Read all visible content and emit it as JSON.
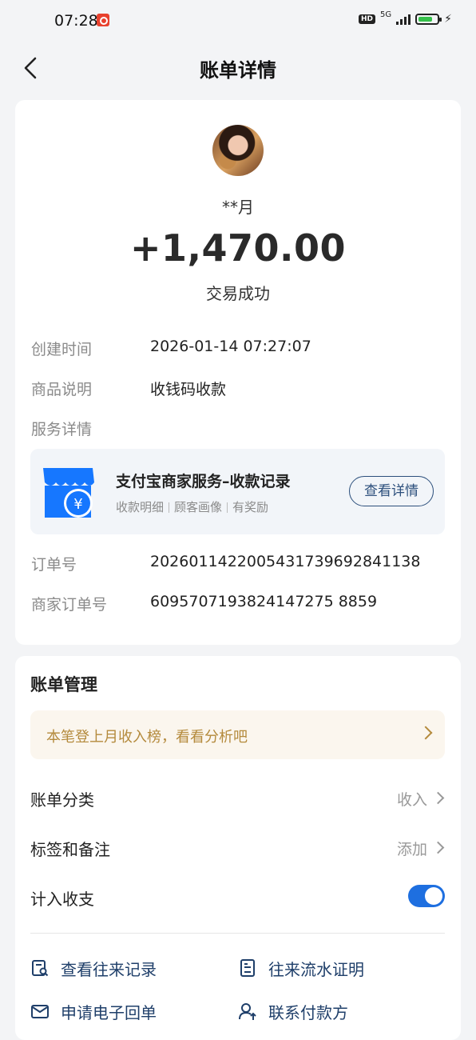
{
  "status_bar": {
    "time": "07:28",
    "net": "5G",
    "hd": "HD",
    "battery_level": 0.75
  },
  "header": {
    "title": "账单详情"
  },
  "transaction": {
    "payer_name": "**月",
    "amount": "+1,470.00",
    "status": "交易成功",
    "details": [
      {
        "label": "创建时间",
        "value": "2026-01-14 07:27:07"
      },
      {
        "label": "商品说明",
        "value": "收钱码收款"
      },
      {
        "label": "服务详情",
        "value": ""
      }
    ],
    "service": {
      "title": "支付宝商家服务–收款记录",
      "tags": [
        "收款明细",
        "顾客画像",
        "有奖励"
      ],
      "button": "查看详情"
    },
    "order_rows": [
      {
        "label": "订单号",
        "value": "2026011422005431739692841138"
      },
      {
        "label": "商家订单号",
        "value": "6095707193824147275 8859"
      }
    ]
  },
  "management": {
    "title": "账单管理",
    "notice": "本笔登上月收入榜，看看分析吧",
    "rows": [
      {
        "label": "账单分类",
        "value": "收入"
      },
      {
        "label": "标签和备注",
        "value": "添加"
      },
      {
        "label": "计入收支",
        "value": ""
      }
    ],
    "toggle_on": true,
    "actions": [
      {
        "label": "查看往来记录",
        "icon": "search-record-icon"
      },
      {
        "label": "往来流水证明",
        "icon": "statement-icon"
      },
      {
        "label": "申请电子回单",
        "icon": "mail-icon"
      },
      {
        "label": "联系付款方",
        "icon": "contact-user-icon"
      }
    ]
  },
  "colors": {
    "accent": "#1e6fe0",
    "link": "#1f3f6a",
    "notice_text": "#b48a3c",
    "notice_bg": "#fbf6ee"
  }
}
